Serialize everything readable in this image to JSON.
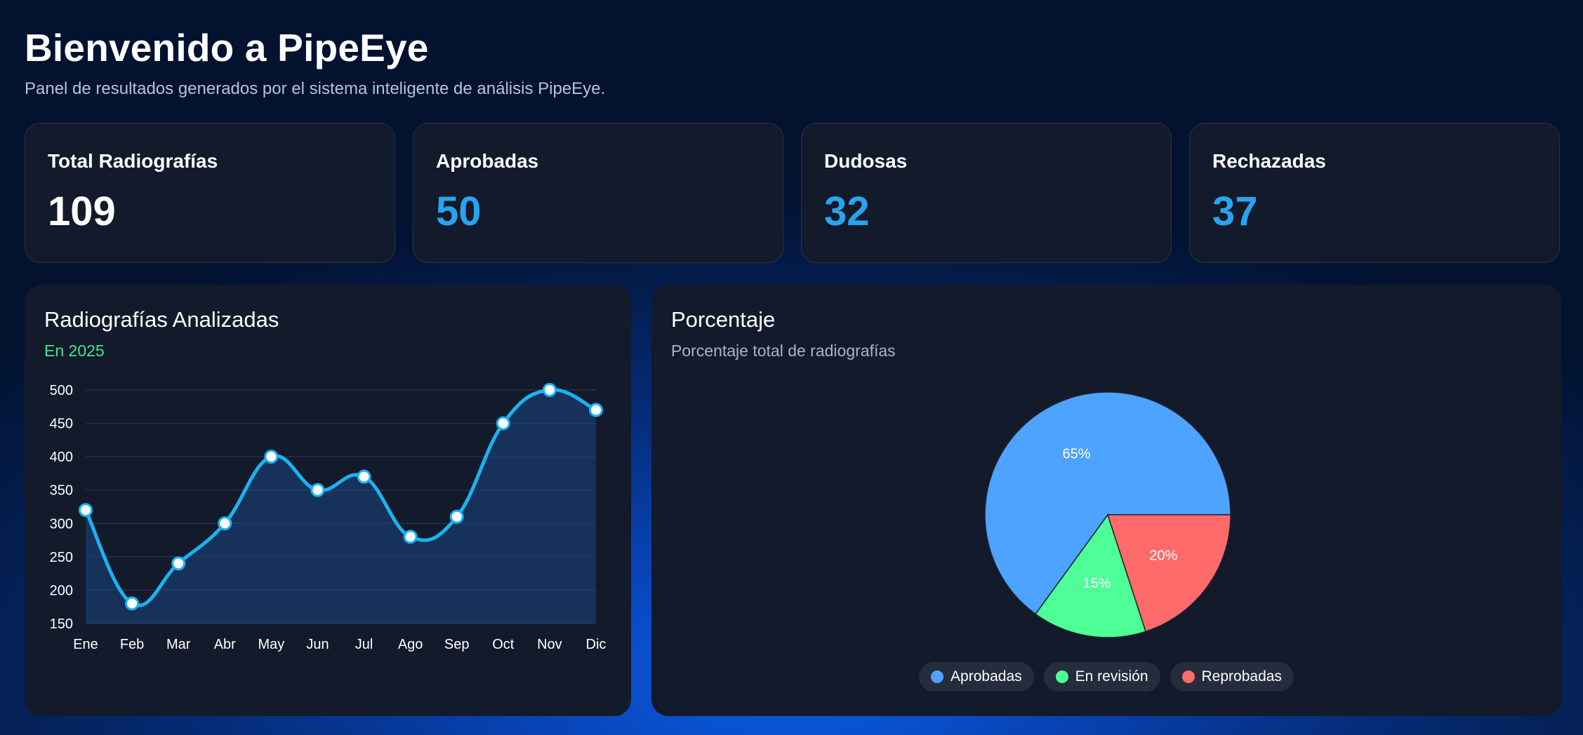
{
  "header": {
    "title": "Bienvenido a PipeEye",
    "subtitle": "Panel de resultados generados por el sistema inteligente de análisis PipeEye."
  },
  "stats": [
    {
      "label": "Total Radiografías",
      "value": "109"
    },
    {
      "label": "Aprobadas",
      "value": "50"
    },
    {
      "label": "Dudosas",
      "value": "32"
    },
    {
      "label": "Rechazadas",
      "value": "37"
    }
  ],
  "colors": {
    "accent": "#2aa3ee",
    "line": "#1ab3f2",
    "approved": "#4da3ff",
    "review": "#4dff96",
    "rejected": "#ff6b6b",
    "year_text": "#3ee88f"
  },
  "line_panel": {
    "title": "Radiografías Analizadas",
    "subtitle": "En 2025"
  },
  "pie_panel": {
    "title": "Porcentaje",
    "subtitle": "Porcentaje total de radiografías"
  },
  "chart_data": [
    {
      "type": "area",
      "title": "Radiografías Analizadas",
      "categories": [
        "Ene",
        "Feb",
        "Mar",
        "Abr",
        "May",
        "Jun",
        "Jul",
        "Ago",
        "Sep",
        "Oct",
        "Nov",
        "Dic"
      ],
      "values": [
        320,
        180,
        240,
        300,
        400,
        350,
        370,
        280,
        310,
        450,
        500,
        470
      ],
      "ylim": [
        150,
        500
      ],
      "yticks": [
        150,
        200,
        250,
        300,
        350,
        400,
        450,
        500
      ],
      "grid": true
    },
    {
      "type": "pie",
      "title": "Porcentaje",
      "labels": [
        "Aprobadas",
        "En revisión",
        "Reprobadas"
      ],
      "values": [
        65,
        15,
        20
      ],
      "value_labels": [
        "65%",
        "15%",
        "20%"
      ],
      "colors": [
        "#4da3ff",
        "#4dff96",
        "#ff6b6b"
      ],
      "legend": "bottom"
    }
  ]
}
